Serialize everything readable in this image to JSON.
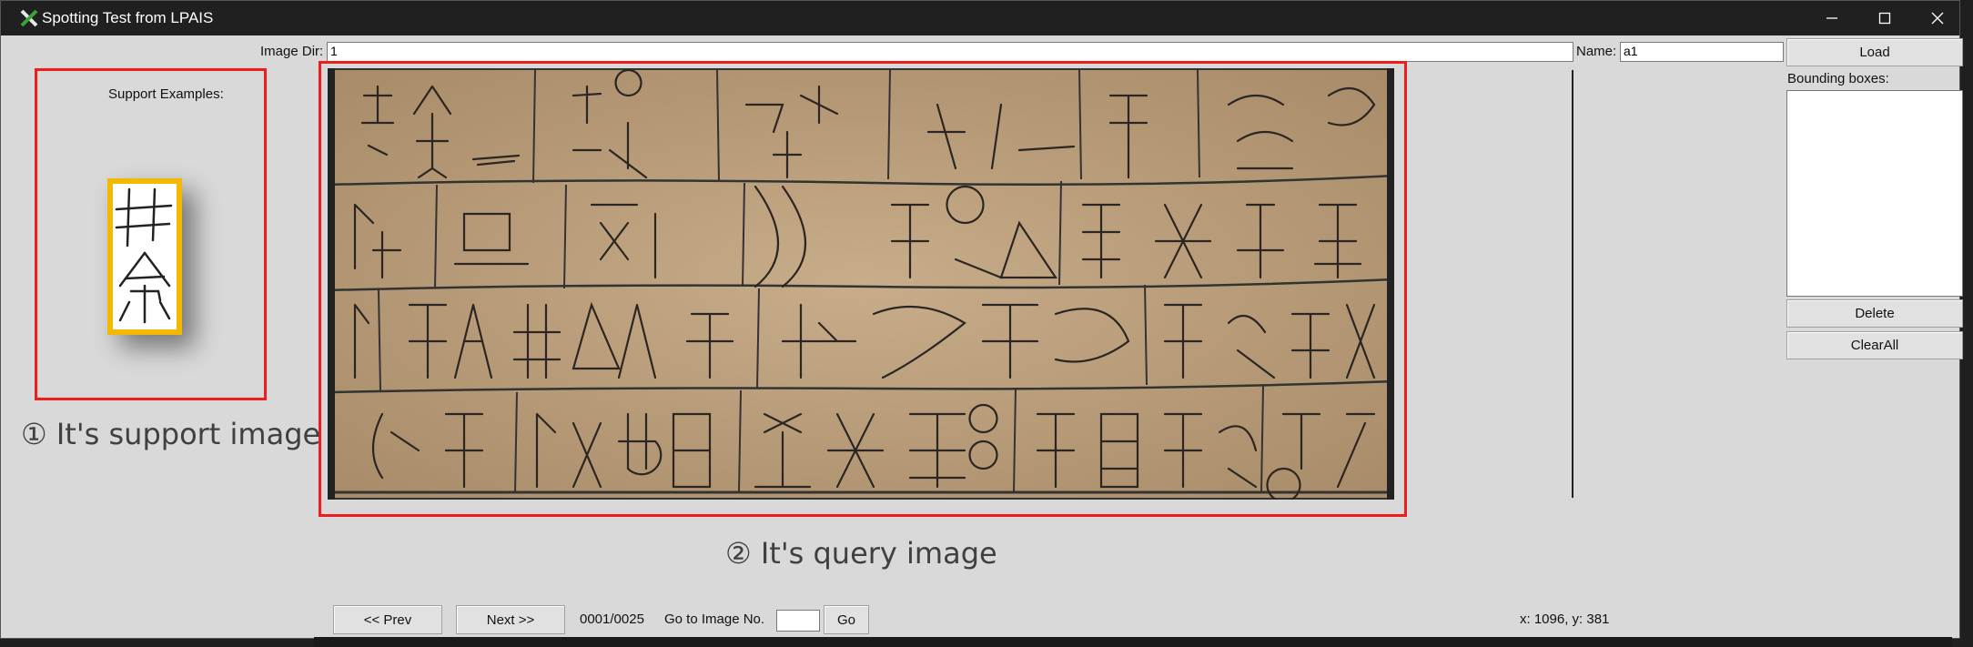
{
  "window": {
    "title": "Spotting Test from LPAIS",
    "controls": [
      "minimize",
      "maximize",
      "close"
    ]
  },
  "top_bar": {
    "image_dir_label": "Image Dir:",
    "image_dir_value": "1",
    "name_label": "Name:",
    "name_value": "a1",
    "load_label": "Load"
  },
  "sidebar": {
    "bounding_boxes_label": "Bounding boxes:",
    "delete_label": "Delete",
    "clear_all_label": "ClearAll"
  },
  "support_panel": {
    "label": "Support Examples:"
  },
  "annotations": {
    "support": "① It's support image",
    "query": "② It's query image"
  },
  "bottom_bar": {
    "prev_label": "<< Prev",
    "next_label": "Next >>",
    "counter": "0001/0025",
    "goto_label": "Go to Image No.",
    "goto_value": "",
    "go_label": "Go",
    "cursor_pos": "x: 1096, y: 381"
  },
  "colors": {
    "highlight_box": "#ee1c1c",
    "support_border": "#f5b800",
    "window_bg": "#d9d9d9",
    "titlebar_bg": "#202020",
    "paper": "#b79b78"
  }
}
